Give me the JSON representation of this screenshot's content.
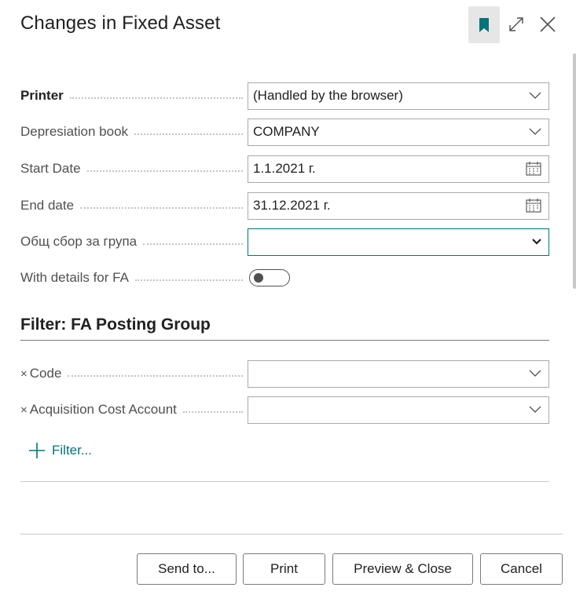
{
  "dialog": {
    "title": "Changes in Fixed Asset"
  },
  "header_icons": {
    "bookmark": "bookmark-icon",
    "expand": "expand-icon",
    "close": "close-icon"
  },
  "fields": {
    "printer": {
      "label": "Printer",
      "value": "(Handled by the browser)"
    },
    "depreciation_book": {
      "label": "Depresiation book",
      "value": "COMPANY"
    },
    "start_date": {
      "label": "Start Date",
      "value": "1.1.2021 г."
    },
    "end_date": {
      "label": "End date",
      "value": "31.12.2021 г."
    },
    "group_total": {
      "label": "Общ сбор за група",
      "value": ""
    },
    "details_for_fa": {
      "label": "With details for FA",
      "checked": false
    }
  },
  "filter_section": {
    "title": "Filter: FA Posting Group",
    "filters": [
      {
        "label": "Code",
        "value": ""
      },
      {
        "label": "Acquisition Cost Account",
        "value": ""
      }
    ],
    "add_filter_label": "Filter...",
    "remove_mark": "×"
  },
  "buttons": {
    "send_to": "Send to...",
    "print": "Print",
    "preview_close": "Preview & Close",
    "cancel": "Cancel"
  },
  "colors": {
    "accent": "#00747a",
    "border": "#a9a9a9",
    "label": "#505050"
  }
}
